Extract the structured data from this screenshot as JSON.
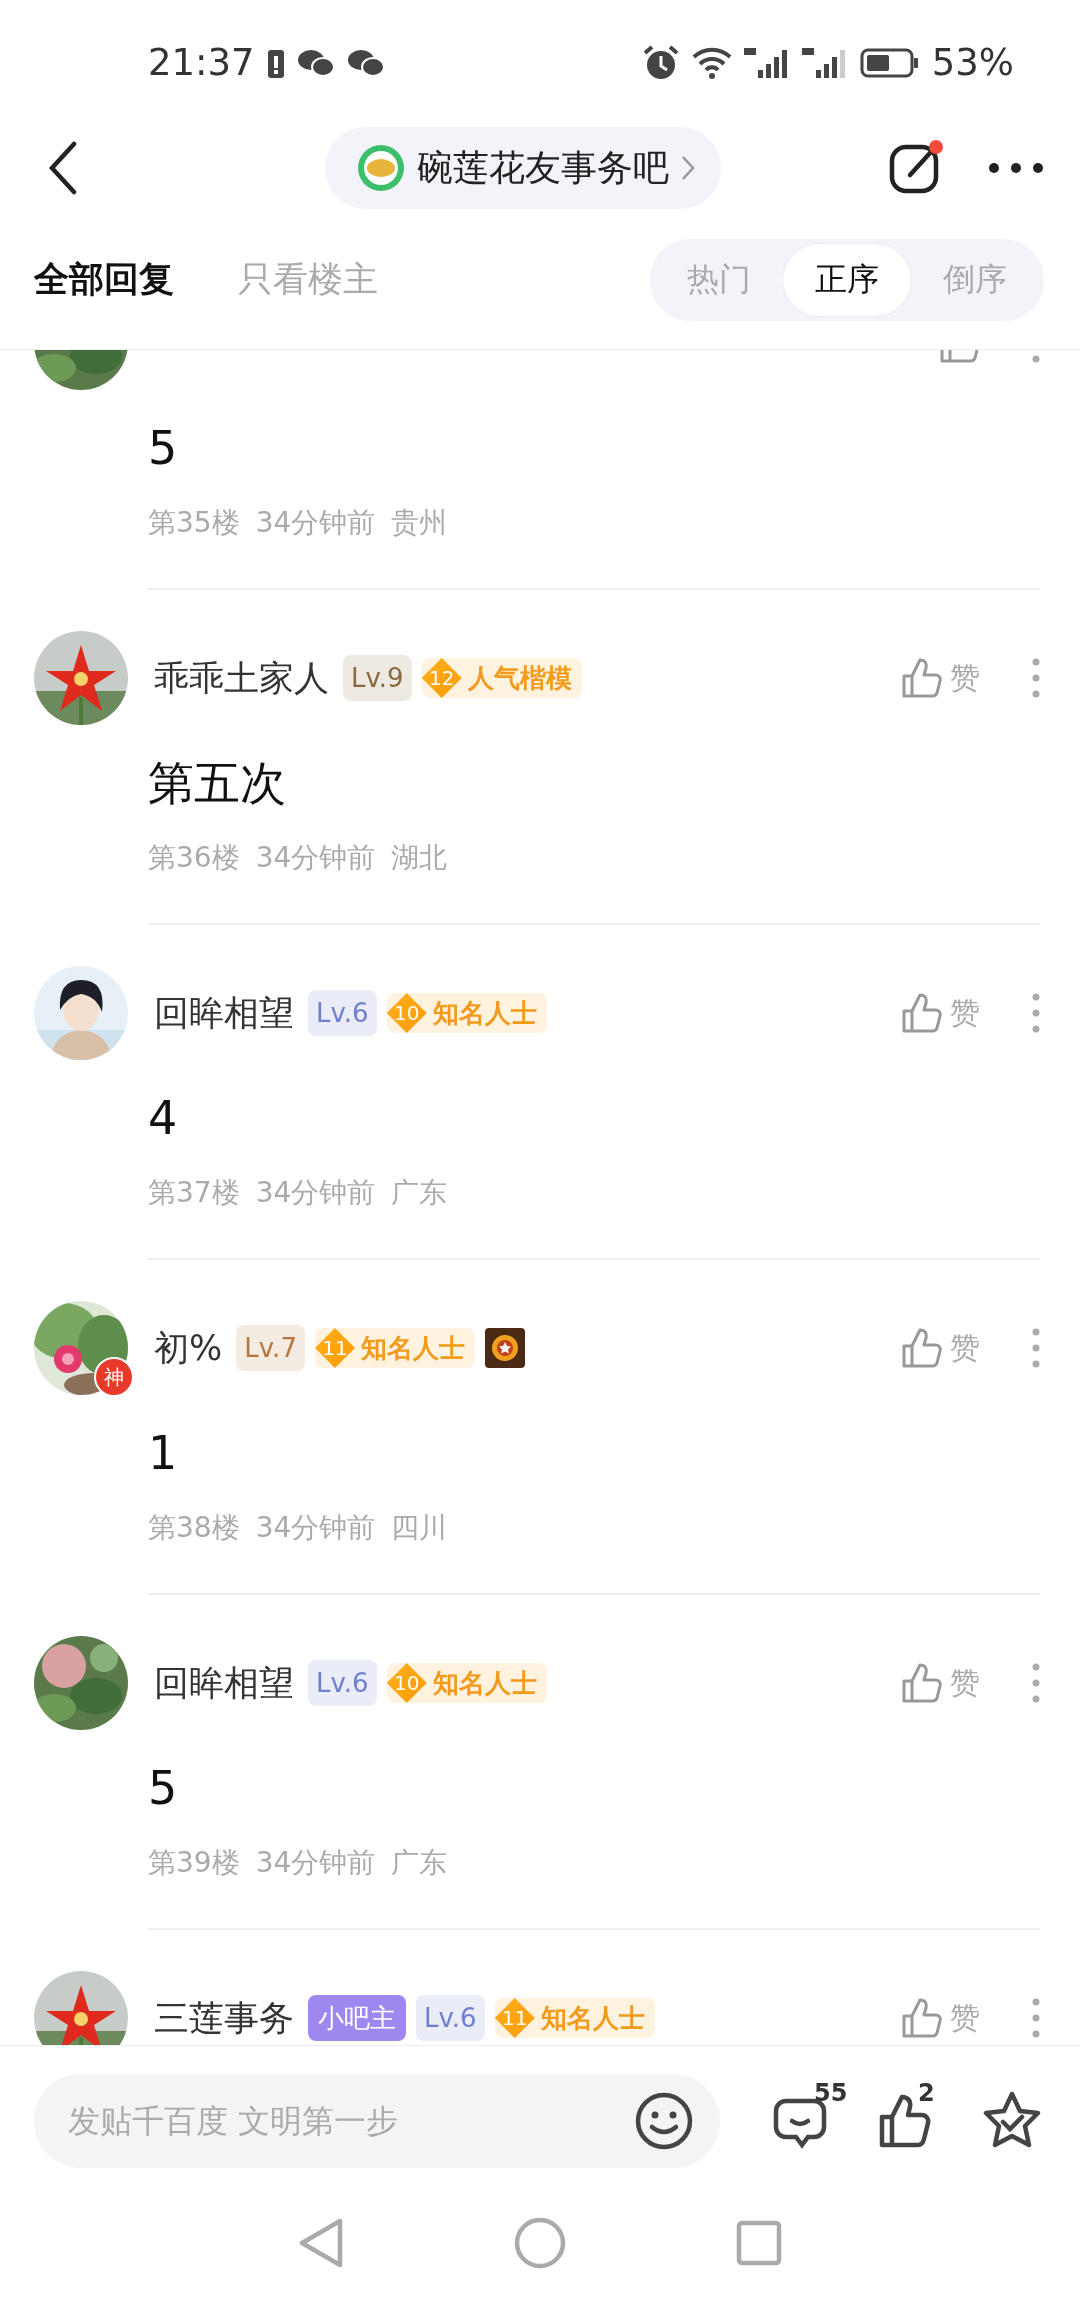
{
  "status_bar": {
    "time": "21:37",
    "battery": "53%"
  },
  "nav": {
    "forum": "碗莲花友事务吧",
    "edit_notification": true
  },
  "tabs": [
    {
      "label": "全部回复",
      "selected": true
    },
    {
      "label": "只看楼主",
      "selected": false
    }
  ],
  "sort": [
    {
      "label": "热门",
      "selected": false
    },
    {
      "label": "正序",
      "selected": true
    },
    {
      "label": "倒序",
      "selected": false
    }
  ],
  "posts": [
    {
      "content": "5",
      "floor": "第35楼",
      "time": "34分钟前",
      "location": "贵州",
      "medal": false
    },
    {
      "name": "乖乖土家人",
      "level": {
        "text": "Lv.9",
        "color": "#8a6a40"
      },
      "honor": {
        "level": "12",
        "title": "人气楷模"
      },
      "like_label": "赞",
      "content": "第五次",
      "floor": "第36楼",
      "time": "34分钟前",
      "location": "湖北",
      "medal": false
    },
    {
      "name": "回眸相望",
      "level": {
        "text": "Lv.6",
        "color": "#6f7fcf"
      },
      "honor": {
        "level": "10",
        "title": "知名人士"
      },
      "like_label": "赞",
      "content": "4",
      "floor": "第37楼",
      "time": "34分钟前",
      "location": "广东",
      "medal": false
    },
    {
      "name": "初%",
      "avatar_badge": "神",
      "level": {
        "text": "Lv.7",
        "color": "#b8773a"
      },
      "honor": {
        "level": "11",
        "title": "知名人士"
      },
      "like_label": "赞",
      "content": "1",
      "floor": "第38楼",
      "time": "34分钟前",
      "location": "四川",
      "medal": true
    },
    {
      "name": "回眸相望",
      "level": {
        "text": "Lv.6",
        "color": "#6f7fcf"
      },
      "honor": {
        "level": "10",
        "title": "知名人士"
      },
      "like_label": "赞",
      "content": "5",
      "floor": "第39楼",
      "time": "34分钟前",
      "location": "广东",
      "medal": false
    },
    {
      "name": "三莲事务",
      "role": "小吧主",
      "level": {
        "text": "Lv.6",
        "color": "#6f7fcf"
      },
      "honor": {
        "level": "11",
        "title": "知名人士"
      },
      "like_label": "赞",
      "medal": false
    }
  ],
  "bottom_bar": {
    "placeholder": "发贴千百度 文明第一步",
    "comments": "55",
    "likes": "2"
  }
}
